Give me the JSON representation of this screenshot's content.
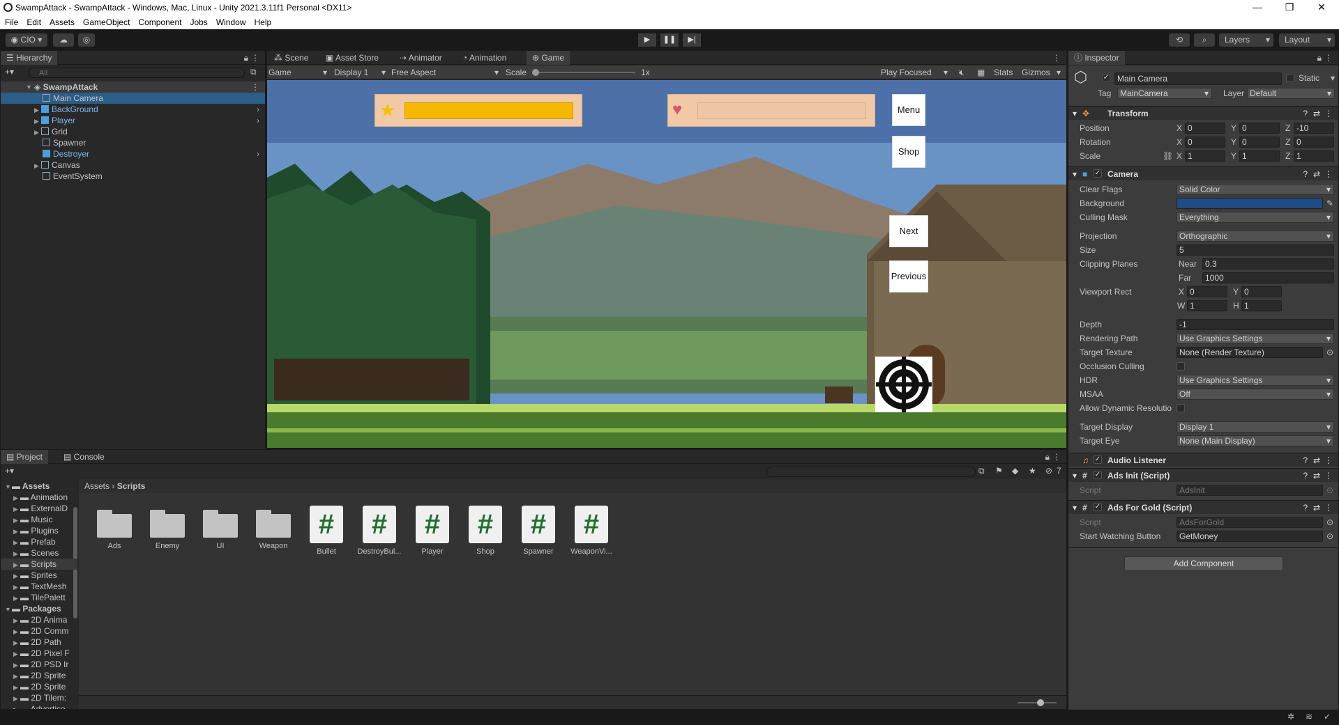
{
  "window": {
    "title": "SwampAttack - SwampAttack - Windows, Mac, Linux - Unity 2021.3.11f1 Personal <DX11>"
  },
  "menu": [
    "File",
    "Edit",
    "Assets",
    "GameObject",
    "Component",
    "Jobs",
    "Window",
    "Help"
  ],
  "toolbar": {
    "account": "CIO",
    "layers": "Layers",
    "layout": "Layout"
  },
  "hierarchy": {
    "tab": "Hierarchy",
    "search_placeholder": "All",
    "scene": "SwampAttack",
    "items": [
      "Main Camera",
      "BackGround",
      "Player",
      "Grid",
      "Spawner",
      "Destroyer",
      "Canvas",
      "EventSystem"
    ]
  },
  "center_tabs": [
    "Scene",
    "Asset Store",
    "Animator",
    "Animation",
    "Game"
  ],
  "game_bar": {
    "mode": "Game",
    "display": "Display 1",
    "aspect": "Free Aspect",
    "scale_label": "Scale",
    "scale_value": "1x",
    "play_focused": "Play Focused",
    "stats": "Stats",
    "gizmos": "Gizmos"
  },
  "game_ui": {
    "menu": "Menu",
    "shop": "Shop",
    "next": "Next",
    "previous": "Previous"
  },
  "inspector": {
    "tab": "Inspector",
    "object_name": "Main Camera",
    "static": "Static",
    "tag_label": "Tag",
    "tag": "MainCamera",
    "layer_label": "Layer",
    "layer": "Default",
    "transform": {
      "title": "Transform",
      "position_label": "Position",
      "rotation_label": "Rotation",
      "scale_label": "Scale",
      "position": [
        "0",
        "0",
        "-10"
      ],
      "rotation": [
        "0",
        "0",
        "0"
      ],
      "scale": [
        "1",
        "1",
        "1"
      ]
    },
    "camera": {
      "title": "Camera",
      "fields": [
        {
          "label": "Clear Flags",
          "value": "Solid Color"
        },
        {
          "label": "Background",
          "value": ""
        },
        {
          "label": "Culling Mask",
          "value": "Everything"
        },
        {
          "label": "Projection",
          "value": "Orthographic"
        },
        {
          "label": "Size",
          "value": "5"
        },
        {
          "label": "Clipping Planes",
          "value": ""
        },
        {
          "label": "Viewport Rect",
          "value": ""
        },
        {
          "label": "Depth",
          "value": "-1"
        },
        {
          "label": "Rendering Path",
          "value": "Use Graphics Settings"
        },
        {
          "label": "Target Texture",
          "value": "None (Render Texture)"
        },
        {
          "label": "Occlusion Culling",
          "value": ""
        },
        {
          "label": "HDR",
          "value": "Use Graphics Settings"
        },
        {
          "label": "MSAA",
          "value": "Off"
        },
        {
          "label": "Allow Dynamic Resolutio",
          "value": ""
        },
        {
          "label": "Target Display",
          "value": "Display 1"
        },
        {
          "label": "Target Eye",
          "value": "None (Main Display)"
        }
      ],
      "near_label": "Near",
      "near": "0.3",
      "far_label": "Far",
      "far": "1000",
      "vx": "0",
      "vy": "0",
      "vw": "1",
      "vh": "1",
      "background_color": "#1e4c87"
    },
    "audio_listener": "Audio Listener",
    "ads_init": {
      "title": "Ads Init (Script)",
      "script_label": "Script",
      "script": "AdsInit"
    },
    "ads_gold": {
      "title": "Ads For Gold (Script)",
      "script_label": "Script",
      "script": "AdsForGold",
      "button_label": "Start Watching Button",
      "button": "GetMoney"
    },
    "add_component": "Add Component"
  },
  "project": {
    "tabs": [
      "Project",
      "Console"
    ],
    "breadcrumb": [
      "Assets",
      "Scripts"
    ],
    "tree_assets": "Assets",
    "assets": [
      "Animation",
      "ExternalD",
      "Music",
      "Plugins",
      "Prefab",
      "Scenes",
      "Scripts",
      "Sprites",
      "TextMesh",
      "TilePalett"
    ],
    "tree_packages": "Packages",
    "packages": [
      "2D Anima",
      "2D Comm",
      "2D Path",
      "2D Pixel F",
      "2D PSD Ir",
      "2D Sprite",
      "2D Sprite",
      "2D Tilem:",
      "Advertise"
    ],
    "folders": [
      "Ads",
      "Enemy",
      "UI",
      "Weapon"
    ],
    "scripts": [
      "Bullet",
      "DestroyBul...",
      "Player",
      "Shop",
      "Spawner",
      "WeaponVi..."
    ],
    "hidden_count": "7"
  }
}
